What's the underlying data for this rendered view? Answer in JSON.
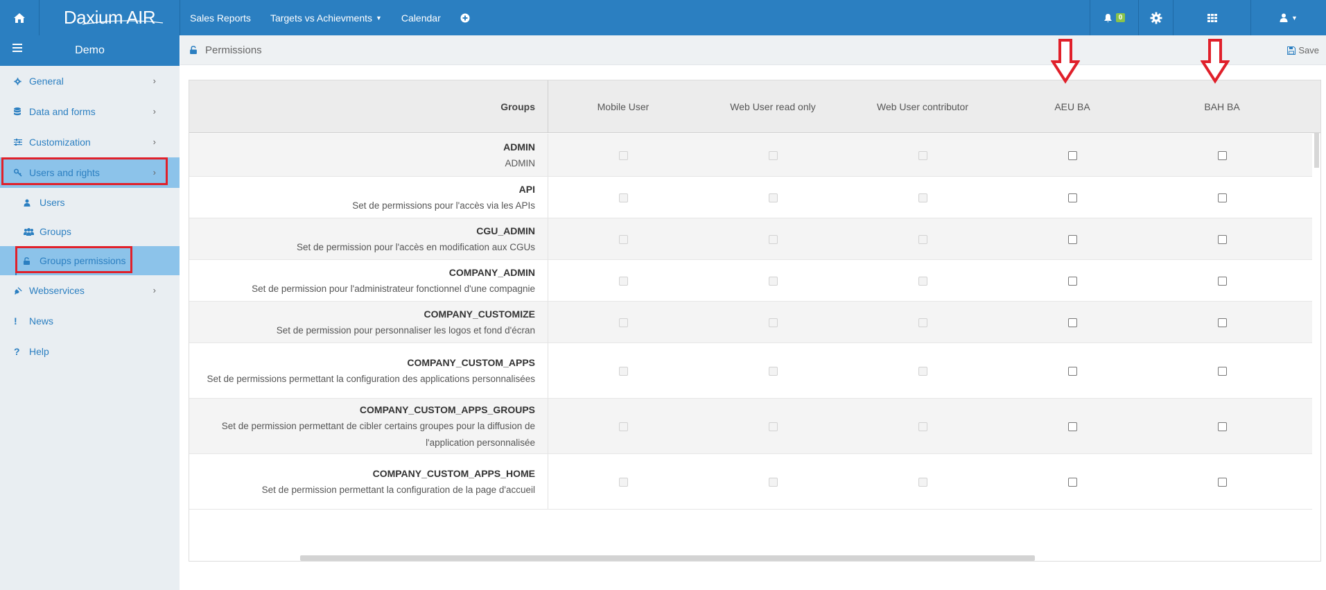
{
  "app": {
    "logo": "Daxium AIR",
    "nav": [
      {
        "label": "Sales Reports"
      },
      {
        "label": "Targets vs Achievments",
        "dropdown": true
      },
      {
        "label": "Calendar"
      }
    ],
    "notifications_count": "0",
    "accent_color": "#2b7fc1"
  },
  "sidebar": {
    "title": "Demo",
    "items": [
      {
        "label": "General",
        "icon": "gear-icon"
      },
      {
        "label": "Data and forms",
        "icon": "database-icon"
      },
      {
        "label": "Customization",
        "icon": "sliders-icon"
      },
      {
        "label": "Users and rights",
        "icon": "key-icon"
      },
      {
        "label": "Users",
        "icon": "user-icon"
      },
      {
        "label": "Groups",
        "icon": "users-icon"
      },
      {
        "label": "Groups permissions",
        "icon": "lock-icon"
      },
      {
        "label": "Webservices",
        "icon": "plug-icon"
      },
      {
        "label": "News",
        "icon": "exclamation-icon"
      },
      {
        "label": "Help",
        "icon": "question-icon"
      }
    ]
  },
  "page": {
    "title": "Permissions",
    "save_label": "Save"
  },
  "table": {
    "groups_header": "Groups",
    "columns": [
      "Mobile User",
      "Web User read only",
      "Web User contributor",
      "AEU BA",
      "BAH BA"
    ],
    "rows": [
      {
        "name": "ADMIN",
        "desc": "ADMIN"
      },
      {
        "name": "API",
        "desc": "Set de permissions pour l'accès via les APIs"
      },
      {
        "name": "CGU_ADMIN",
        "desc": "Set de permission pour l'accès en modification aux CGUs"
      },
      {
        "name": "COMPANY_ADMIN",
        "desc": "Set de permission pour l'administrateur fonctionnel d'une compagnie"
      },
      {
        "name": "COMPANY_CUSTOMIZE",
        "desc": "Set de permission pour personnaliser les logos et fond d'écran"
      },
      {
        "name": "COMPANY_CUSTOM_APPS",
        "desc": "Set de permissions permettant la configuration des applications personnalisées"
      },
      {
        "name": "COMPANY_CUSTOM_APPS_GROUPS",
        "desc": "Set de permission permettant de cibler certains groupes pour la diffusion de l'application personnalisée"
      },
      {
        "name": "COMPANY_CUSTOM_APPS_HOME",
        "desc": "Set de permission permettant la configuration de la page d'accueil"
      }
    ]
  }
}
